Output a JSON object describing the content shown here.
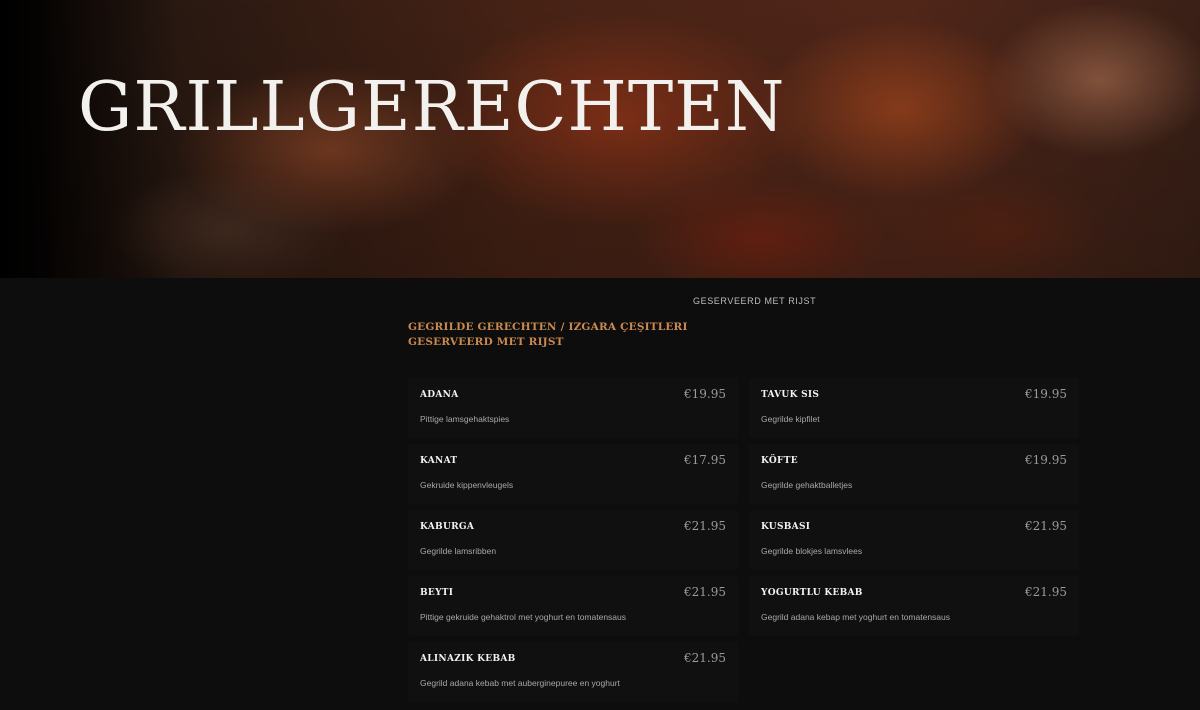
{
  "hero": {
    "title": "GRILLGERECHTEN"
  },
  "section": {
    "subtitle": "GESERVEERD MET RIJST",
    "title": "GEGRILDE GERECHTEN / IZGARA ÇEŞITLERI GESERVEERD MET RIJST"
  },
  "menu": {
    "items": [
      {
        "name": "ADANA",
        "price": "€19.95",
        "desc": "Pittige lamsgehaktspies"
      },
      {
        "name": "TAVUK SIS",
        "price": "€19.95",
        "desc": "Gegrilde kipfilet"
      },
      {
        "name": "KANAT",
        "price": "€17.95",
        "desc": "Gekruide kippenvleugels"
      },
      {
        "name": "KÖFTE",
        "price": "€19.95",
        "desc": "Gegrilde gehaktballetjes"
      },
      {
        "name": "KABURGA",
        "price": "€21.95",
        "desc": "Gegrilde lamsribben"
      },
      {
        "name": "KUSBASI",
        "price": "€21.95",
        "desc": "Gegrilde blokjes lamsvlees"
      },
      {
        "name": "BEYTI",
        "price": "€21.95",
        "desc": "Pittige gekruide gehaktrol met yoghurt en tomatensaus"
      },
      {
        "name": "YOGURTLU KEBAB",
        "price": "€21.95",
        "desc": "Gegrild adana kebap met yoghurt en tomatensaus"
      },
      {
        "name": "ALINAZIK KEBAB",
        "price": "€21.95",
        "desc": "Gegrild adana kebab met auberginepuree en yoghurt"
      }
    ]
  }
}
